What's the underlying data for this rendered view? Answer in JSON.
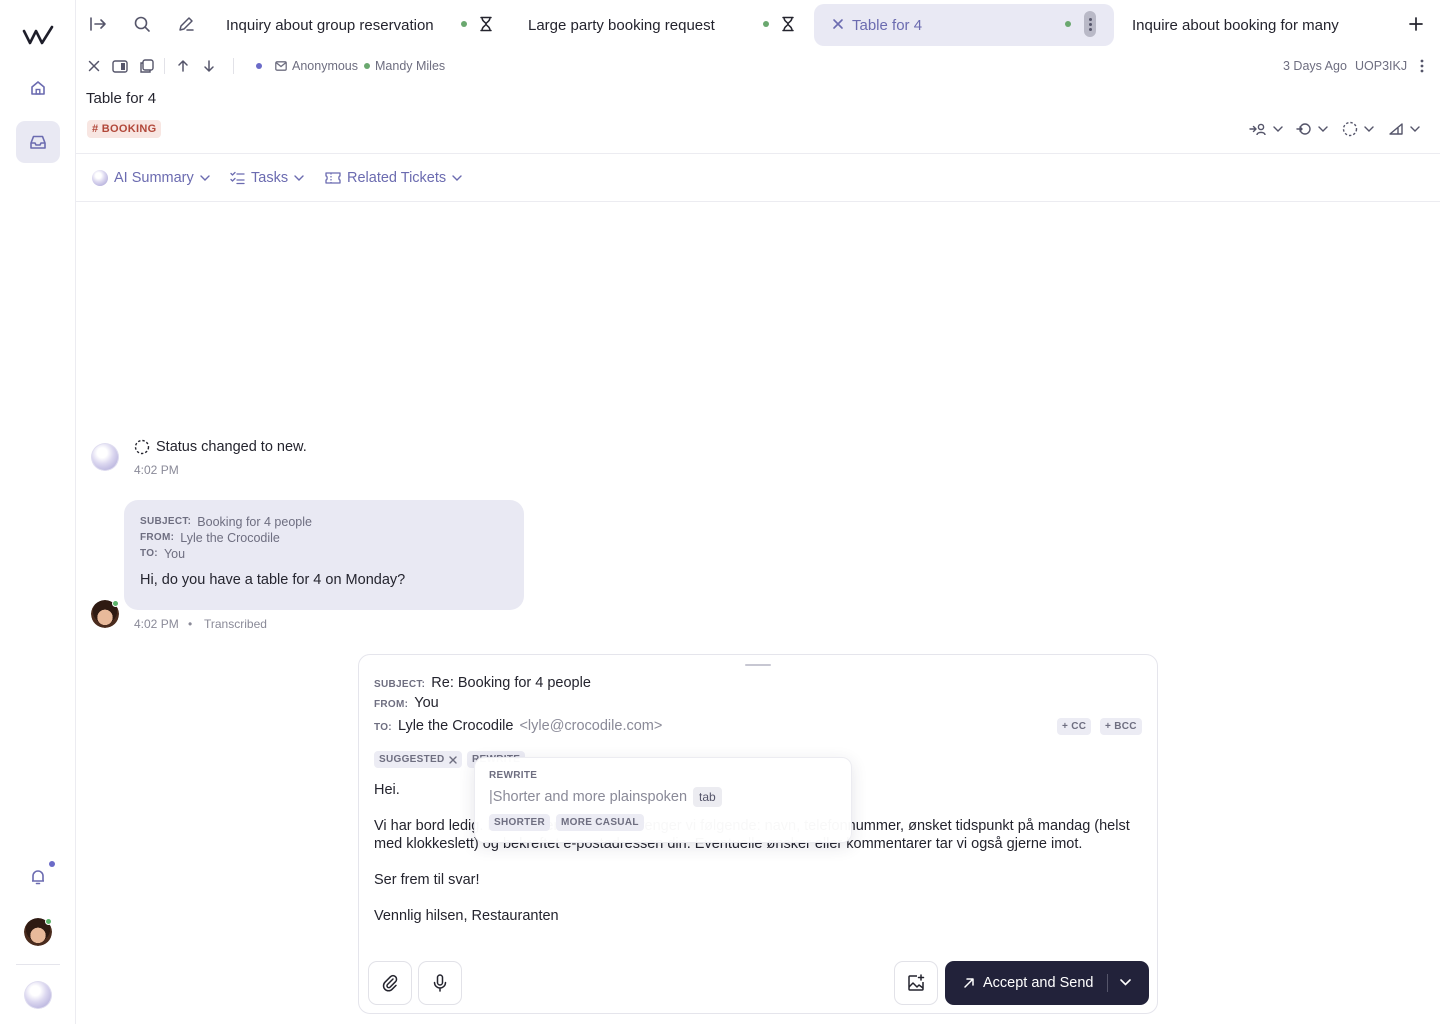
{
  "tabs": [
    {
      "label": "Inquiry about group reservation"
    },
    {
      "label": "Large party booking request"
    },
    {
      "label": "Table for 4"
    },
    {
      "label": "Inquire about booking for many"
    }
  ],
  "ticket": {
    "requester": "Anonymous",
    "assignee": "Mandy Miles",
    "age": "3 Days Ago",
    "id": "UOP3IKJ",
    "title": "Table for 4",
    "tag": "# BOOKING"
  },
  "subtabs": {
    "ai_summary": "AI Summary",
    "tasks": "Tasks",
    "related": "Related Tickets"
  },
  "timeline": {
    "event": {
      "text": "Status changed to new.",
      "time": "4:02 PM"
    },
    "message": {
      "subject_label": "SUBJECT:",
      "subject": "Booking for 4 people",
      "from_label": "FROM:",
      "from": "Lyle the Crocodile",
      "to_label": "TO:",
      "to": "You",
      "body": "Hi, do you have a table for 4 on Monday?",
      "time": "4:02 PM",
      "separator": "•",
      "status": "Transcribed"
    }
  },
  "composer": {
    "subject_label": "SUBJECT:",
    "subject": "Re: Booking for 4 people",
    "from_label": "FROM:",
    "from": "You",
    "to_label": "TO:",
    "to_name": "Lyle the Crocodile",
    "to_email": "<lyle@crocodile.com>",
    "cc": "+ CC",
    "bcc": "+ BCC",
    "chip_suggested": "SUGGESTED",
    "chip_rewrite": "REWRITE",
    "body": {
      "greeting": "Hei.",
      "p1": "Vi har bord ledig. For å reservere bordet trenger vi følgende: navn, telefonnummer, ønsket tidspunkt på mandag (helst med klokkeslett) og bekreftet e-postadressen din. Eventuelle ønsker eller kommentarer tar vi også gjerne imot.",
      "p2": "Ser frem til svar!",
      "p3": "Vennlig hilsen, Restauranten"
    },
    "send_label": "Accept and Send"
  },
  "rewrite_popup": {
    "label": "REWRITE",
    "suggestion": "|Shorter and more plainspoken",
    "key": "tab",
    "options": [
      "SHORTER",
      "MORE CASUAL"
    ]
  }
}
